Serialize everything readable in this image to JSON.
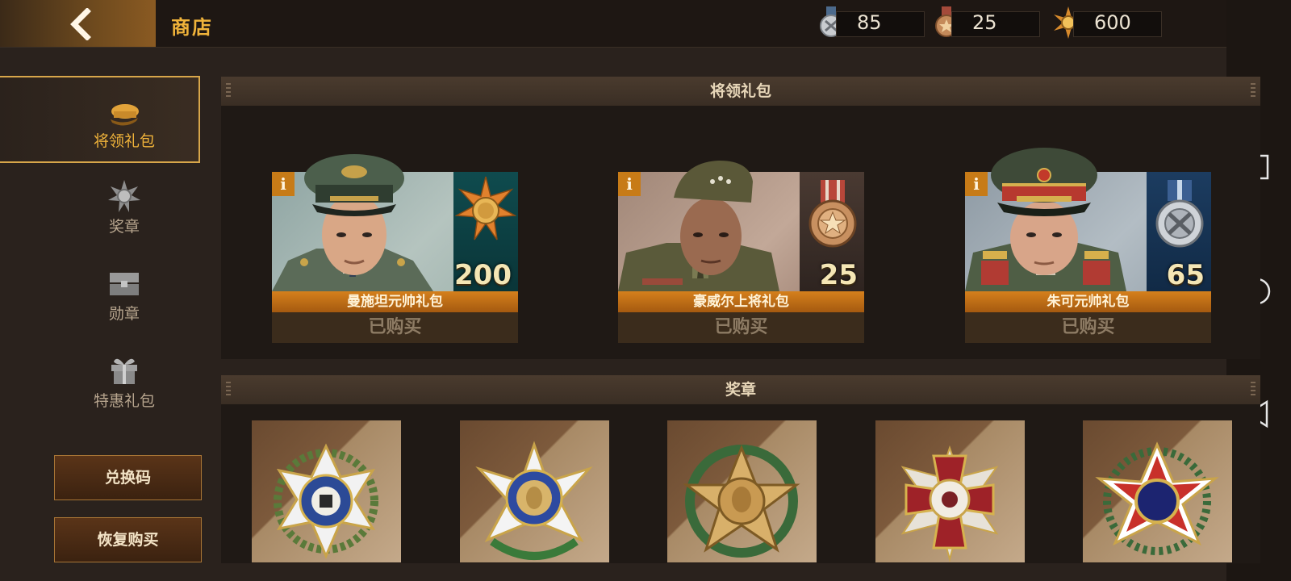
{
  "header": {
    "title": "商店",
    "currencies": [
      {
        "icon": "silver-medal-icon",
        "value": "85"
      },
      {
        "icon": "bronze-medal-icon",
        "value": "25"
      },
      {
        "icon": "gold-sun-medal-icon",
        "value": "600"
      }
    ]
  },
  "sidebar": {
    "items": [
      {
        "label": "将领礼包",
        "icon": "officer-cap-icon",
        "active": true
      },
      {
        "label": "奖章",
        "icon": "sun-medal-icon",
        "active": false
      },
      {
        "label": "勋章",
        "icon": "chest-icon",
        "active": false
      },
      {
        "label": "特惠礼包",
        "icon": "gift-icon",
        "active": false
      }
    ],
    "redeem_label": "兑换码",
    "restore_label": "恢复购买"
  },
  "sections": {
    "generals_title": "将领礼包",
    "medals_title": "奖章"
  },
  "generals": [
    {
      "info": "i",
      "amount": "200",
      "name": "曼施坦元帅礼包",
      "status": "已购买",
      "reward_icon": "gold-sun-medal-icon"
    },
    {
      "info": "i",
      "amount": "25",
      "name": "豪威尔上将礼包",
      "status": "已购买",
      "reward_icon": "bronze-medal-icon"
    },
    {
      "info": "i",
      "amount": "65",
      "name": "朱可元帅礼包",
      "status": "已购买",
      "reward_icon": "silver-medal-icon"
    }
  ],
  "medals": [
    {
      "icon": "blue-cross-medal-icon"
    },
    {
      "icon": "white-star-medal-icon"
    },
    {
      "icon": "gold-star-wreath-medal-icon"
    },
    {
      "icon": "red-cross-medal-icon"
    },
    {
      "icon": "red-white-star-medal-icon"
    }
  ],
  "colors": {
    "accent": "#f0b33a",
    "name_strip": "#c8741a",
    "background": "#2a221d"
  }
}
